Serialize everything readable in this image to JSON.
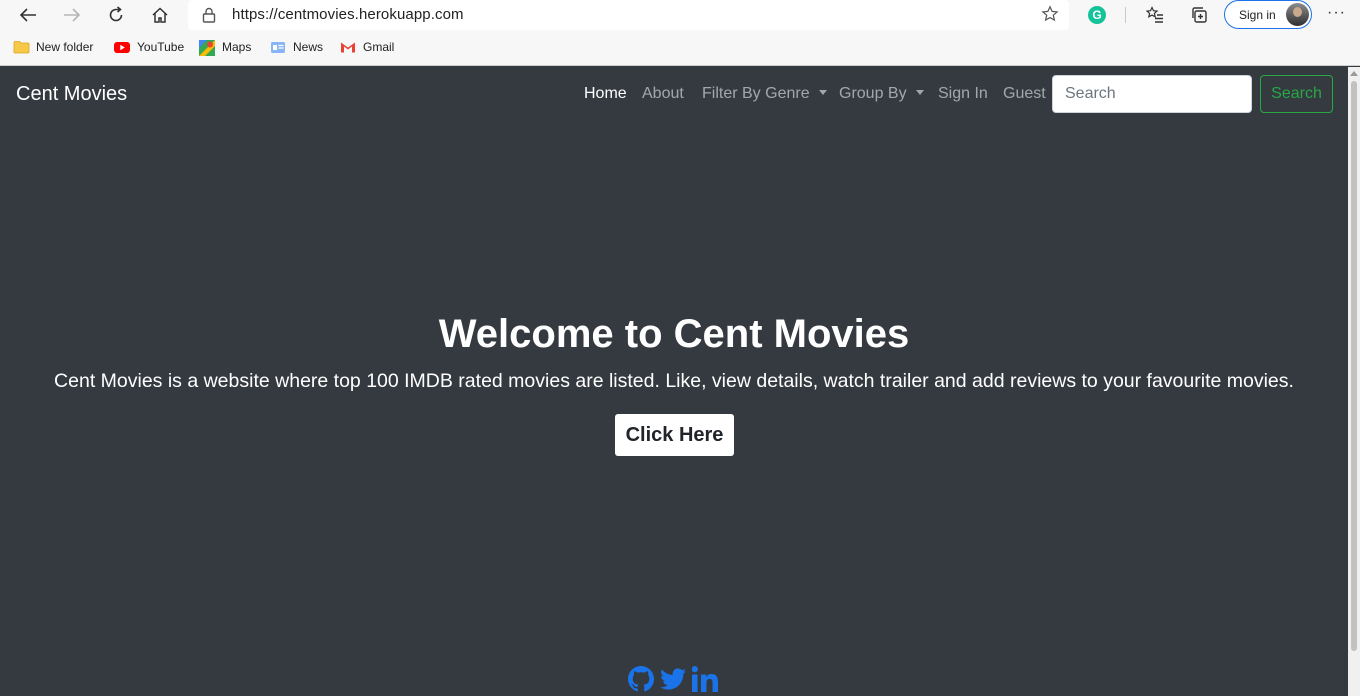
{
  "browser": {
    "url": "https://centmovies.herokuapp.com",
    "signin_label": "Sign in",
    "more_label": "···",
    "grammarly_letter": "G",
    "bookmarks": [
      {
        "label": "New folder",
        "icon": "folder-icon"
      },
      {
        "label": "YouTube",
        "icon": "youtube-icon"
      },
      {
        "label": "Maps",
        "icon": "maps-icon"
      },
      {
        "label": "News",
        "icon": "news-icon"
      },
      {
        "label": "Gmail",
        "icon": "gmail-icon"
      }
    ]
  },
  "navbar": {
    "brand": "Cent Movies",
    "links": [
      {
        "label": "Home",
        "active": true
      },
      {
        "label": "About"
      },
      {
        "label": "Filter By Genre",
        "dropdown": true
      },
      {
        "label": "Group By",
        "dropdown": true
      },
      {
        "label": "Sign In"
      },
      {
        "label": "Guest"
      }
    ],
    "search_placeholder": "Search",
    "search_button": "Search"
  },
  "hero": {
    "title": "Welcome to Cent Movies",
    "description": "Cent Movies is a website where top 100 IMDB rated movies are listed. Like, view details, watch trailer and add reviews to your favourite movies.",
    "button": "Click Here"
  },
  "footer": {
    "socials": [
      "github-icon",
      "twitter-icon",
      "linkedin-icon"
    ]
  },
  "colors": {
    "page_bg": "#343a40",
    "search_green": "#28a745",
    "social_blue": "#1a73e8",
    "signin_border": "#1a73e8"
  }
}
